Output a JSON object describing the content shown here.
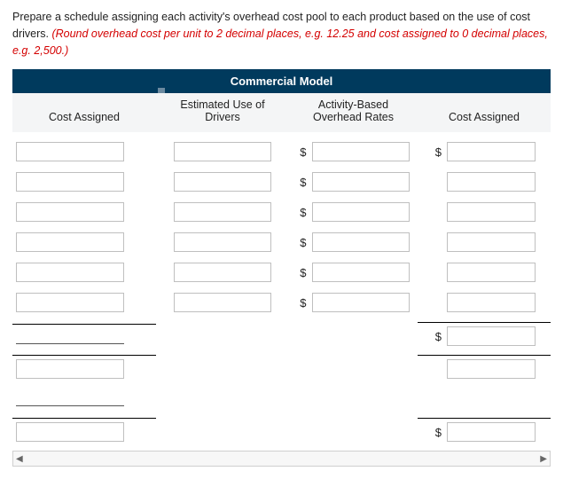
{
  "instruction": {
    "main": "Prepare a schedule assigning each activity's overhead cost pool to each product based on the use of cost drivers. ",
    "round": "(Round overhead cost per unit to 2 decimal places, e.g. 12.25 and cost assigned to 0 decimal places, e.g. 2,500.)"
  },
  "banner": "Commercial Model",
  "headers": {
    "cost_assigned_left": "Cost Assigned",
    "estimated": "Estimated Use of Drivers",
    "rates": "Activity-Based Overhead Rates",
    "cost_assigned_right": "Cost Assigned"
  },
  "currency": "$",
  "scroll": {
    "left": "◀",
    "right": "▶"
  },
  "rows": [
    {
      "left_style": "box",
      "est": true,
      "rate_dollar": true,
      "rate": true,
      "right_dollar": true,
      "right": true,
      "rule": false
    },
    {
      "left_style": "box",
      "est": true,
      "rate_dollar": true,
      "rate": true,
      "right_dollar": false,
      "right": true,
      "rule": false
    },
    {
      "left_style": "box",
      "est": true,
      "rate_dollar": true,
      "rate": true,
      "right_dollar": false,
      "right": true,
      "rule": false
    },
    {
      "left_style": "box",
      "est": true,
      "rate_dollar": true,
      "rate": true,
      "right_dollar": false,
      "right": true,
      "rule": false
    },
    {
      "left_style": "box",
      "est": true,
      "rate_dollar": true,
      "rate": true,
      "right_dollar": false,
      "right": true,
      "rule": false
    },
    {
      "left_style": "box",
      "est": true,
      "rate_dollar": true,
      "rate": true,
      "right_dollar": false,
      "right": true,
      "rule": false
    },
    {
      "left_style": "line",
      "est": false,
      "rate_dollar": false,
      "rate": false,
      "right_dollar": true,
      "right": true,
      "rule": true
    },
    {
      "left_style": "box",
      "est": false,
      "rate_dollar": false,
      "rate": false,
      "right_dollar": false,
      "right": true,
      "rule": true
    },
    {
      "left_style": "line",
      "est": false,
      "rate_dollar": false,
      "rate": false,
      "right_dollar": false,
      "right": false,
      "rule": false
    },
    {
      "left_style": "box",
      "est": false,
      "rate_dollar": false,
      "rate": false,
      "right_dollar": true,
      "right": true,
      "rule": true
    }
  ]
}
